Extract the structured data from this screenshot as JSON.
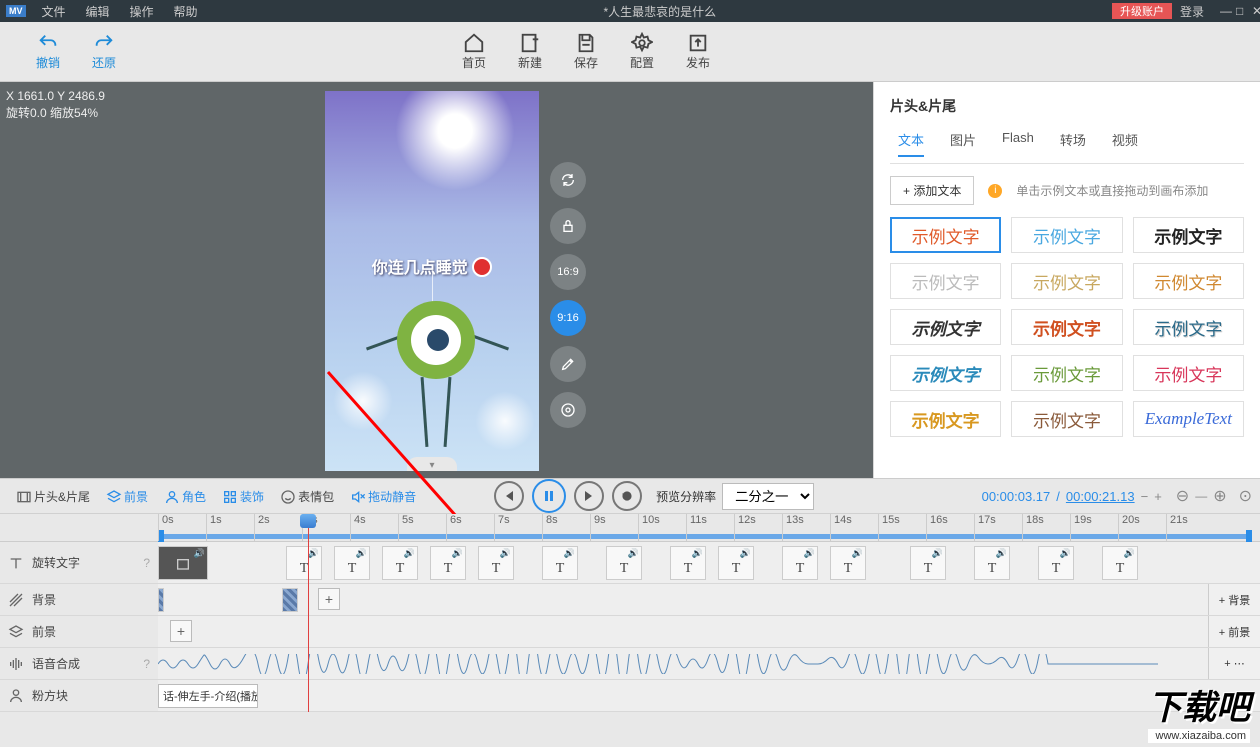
{
  "titlebar": {
    "logo": "MV",
    "menus": [
      "文件",
      "编辑",
      "操作",
      "帮助"
    ],
    "title": "*人生最悲哀的是什么",
    "upgrade": "升级账户",
    "login": "登录"
  },
  "actionbar": {
    "undo": "撤销",
    "redo": "还原",
    "home": "首页",
    "new": "新建",
    "save": "保存",
    "config": "配置",
    "publish": "发布"
  },
  "canvas": {
    "coords": "X 1661.0 Y 2486.9",
    "transform": "旋转0.0 缩放54%",
    "caption": "你连几点睡觉",
    "ratios": {
      "r169": "16:9",
      "r916": "9:16"
    }
  },
  "rightpanel": {
    "title": "片头&片尾",
    "tabs": [
      "文本",
      "图片",
      "Flash",
      "转场",
      "视频"
    ],
    "addtext": "+ 添加文本",
    "hint": "单击示例文本或直接拖动到画布添加",
    "samples": [
      "示例文字",
      "示例文字",
      "示例文字",
      "示例文字",
      "示例文字",
      "示例文字",
      "示例文字",
      "示例文字",
      "示例文字",
      "示例文字",
      "示例文字",
      "示例文字",
      "示例文字",
      "示例文字",
      "ExampleText"
    ],
    "sample_styles": [
      "color:#e05a2a;",
      "color:#4aa8e0;",
      "color:#222;font-weight:900;",
      "color:#bbb;",
      "color:#c8a860;font-family:cursive;",
      "color:#d08830;",
      "color:#333;font-weight:900;font-style:italic;",
      "color:#d05020;font-weight:900;background:linear-gradient(#fff,#fff);",
      "color:#2a6a8a;text-shadow:1px 1px #ccc;",
      "color:#2a8aba;font-weight:bold;font-style:italic;",
      "color:#6a9a3a;",
      "color:#d8365a;",
      "color:#d89820;font-weight:900;",
      "color:#8a5a3a;font-family:serif;",
      "color:#3a6ad8;font-style:italic;font-family:serif;"
    ]
  },
  "toolbar2": {
    "items": [
      {
        "label": "片头&片尾",
        "icon": "film"
      },
      {
        "label": "前景",
        "icon": "layers",
        "blue": true
      },
      {
        "label": "角色",
        "icon": "user",
        "blue": true
      },
      {
        "label": "装饰",
        "icon": "grid",
        "blue": true
      },
      {
        "label": "表情包",
        "icon": "smile"
      },
      {
        "label": "拖动静音",
        "icon": "mute",
        "blue": true
      }
    ],
    "res_label": "预览分辨率",
    "res_value": "二分之一",
    "time_now": "00:00:03.17",
    "time_total": "00:00:21.13"
  },
  "timeline": {
    "ticks": [
      "0s",
      "1s",
      "2s",
      "3s",
      "4s",
      "5s",
      "6s",
      "7s",
      "8s",
      "9s",
      "10s",
      "11s",
      "12s",
      "13s",
      "14s",
      "15s",
      "16s",
      "17s",
      "18s",
      "19s",
      "20s",
      "21s"
    ],
    "tracks": {
      "rotate": "旋转文字",
      "bg": "背景",
      "fg": "前景",
      "tts": "语音合成",
      "pink": "粉方块"
    },
    "end": {
      "bg": "+ 背景",
      "fg": "+ 前景"
    },
    "segclip": "话-伸左手-介绍(播放完",
    "text_clip_positions": [
      128,
      176,
      224,
      272,
      320,
      384,
      448,
      512,
      560,
      624,
      672,
      752,
      816,
      880,
      944
    ]
  },
  "watermark": {
    "big": "下载吧",
    "url": "www.xiazaiba.com"
  }
}
